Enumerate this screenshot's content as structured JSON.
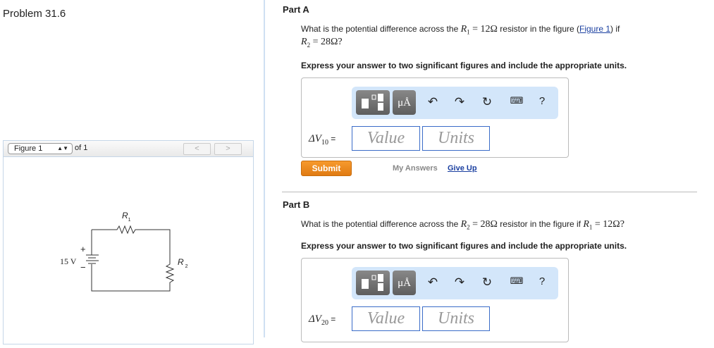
{
  "problem_title": "Problem 31.6",
  "figure": {
    "select": "Figure 1",
    "of": "of 1",
    "prev": "<",
    "next": ">",
    "labels": {
      "r1": "R",
      "r1_sub": "1",
      "r2": "R",
      "r2_sub": "2",
      "voltage": "15 V",
      "plus": "+",
      "minus": "−"
    }
  },
  "part_a": {
    "title": "Part A",
    "q_pre": "What is the potential difference across the ",
    "q_r": "R",
    "q_rsub": "1",
    "q_val": " = 12Ω",
    "q_mid": " resistor in the figure (",
    "q_link": "Figure 1",
    "q_post": ") if",
    "q_line2_r": "R",
    "q_line2_sub": "2",
    "q_line2_val": " = 28Ω?",
    "instruction": "Express your answer to two significant figures and include the appropriate units.",
    "label_d": "ΔV",
    "label_sub": "10",
    "label_eq": " =",
    "value_placeholder": "Value",
    "units_placeholder": "Units",
    "submit": "Submit",
    "my_answers": "My Answers",
    "give_up": "Give Up"
  },
  "part_b": {
    "title": "Part B",
    "q_pre": "What is the potential difference across the ",
    "q_r": "R",
    "q_rsub": "2",
    "q_val": " = 28Ω",
    "q_mid": " resistor in the figure if ",
    "q_r2": "R",
    "q_r2sub": "1",
    "q_val2": " = 12Ω?",
    "instruction": "Express your answer to two significant figures and include the appropriate units.",
    "label_d": "ΔV",
    "label_sub": "20",
    "label_eq": " =",
    "value_placeholder": "Value",
    "units_placeholder": "Units"
  },
  "toolbar": {
    "units_btn": "μÅ",
    "help": "?"
  }
}
